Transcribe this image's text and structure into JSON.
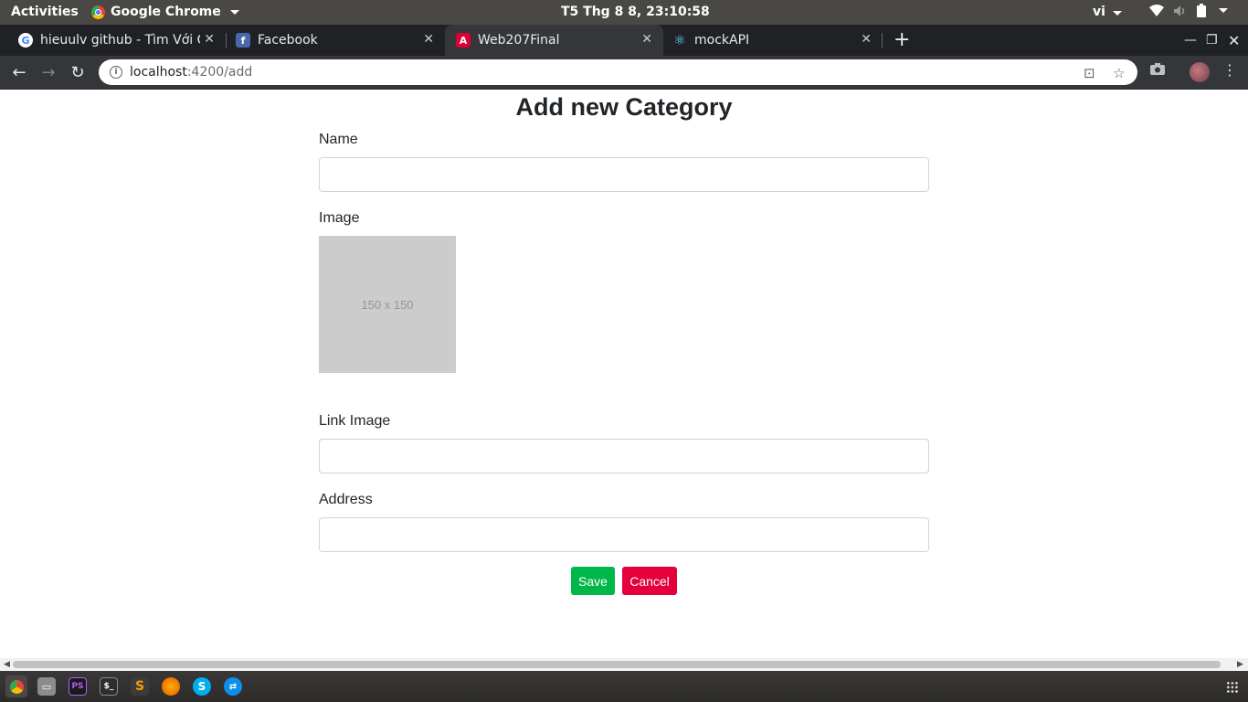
{
  "topbar": {
    "activities": "Activities",
    "app_name": "Google Chrome",
    "clock": "T5 Thg 8  8, 23:10:58",
    "language": "vi"
  },
  "tabs": [
    {
      "title": "hieuulv github - Tìm Với G",
      "icon": "google-icon",
      "active": false
    },
    {
      "title": "Facebook",
      "icon": "facebook-icon",
      "active": false
    },
    {
      "title": "Web207Final",
      "icon": "angular-icon",
      "active": true
    },
    {
      "title": "mockAPI",
      "icon": "react-icon",
      "active": false
    }
  ],
  "address": {
    "host": "localhost",
    "path": ":4200/add"
  },
  "form": {
    "title": "Add new Category",
    "name_label": "Name",
    "name_value": "",
    "image_label": "Image",
    "image_placeholder": "150 x 150",
    "link_label": "Link Image",
    "link_value": "",
    "address_label": "Address",
    "address_value": "",
    "save": "Save",
    "cancel": "Cancel"
  },
  "colors": {
    "save": "#00b74a",
    "cancel": "#e4003a",
    "chrome_dark": "#202124",
    "toolbar": "#35363a"
  }
}
